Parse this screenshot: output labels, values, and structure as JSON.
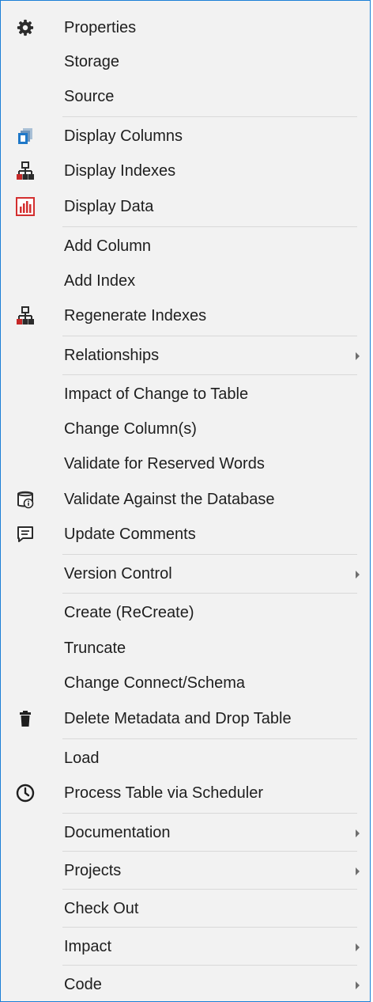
{
  "menu": {
    "items": [
      {
        "label": "Properties",
        "icon": "gear-icon"
      },
      {
        "label": "Storage",
        "icon": ""
      },
      {
        "label": "Source",
        "icon": ""
      },
      {
        "label": "Display Columns",
        "icon": "stacked-columns-icon"
      },
      {
        "label": "Display Indexes",
        "icon": "hierarchy-icon"
      },
      {
        "label": "Display Data",
        "icon": "bar-chart-icon"
      },
      {
        "label": "Add Column",
        "icon": ""
      },
      {
        "label": "Add Index",
        "icon": ""
      },
      {
        "label": "Regenerate Indexes",
        "icon": "hierarchy-icon"
      },
      {
        "label": "Relationships",
        "icon": "",
        "submenu": true
      },
      {
        "label": "Impact of Change to Table",
        "icon": ""
      },
      {
        "label": "Change Column(s)",
        "icon": ""
      },
      {
        "label": "Validate for Reserved Words",
        "icon": ""
      },
      {
        "label": "Validate Against the Database",
        "icon": "database-info-icon"
      },
      {
        "label": "Update Comments",
        "icon": "comment-icon"
      },
      {
        "label": "Version Control",
        "icon": "",
        "submenu": true
      },
      {
        "label": "Create (ReCreate)",
        "icon": ""
      },
      {
        "label": "Truncate",
        "icon": ""
      },
      {
        "label": "Change Connect/Schema",
        "icon": ""
      },
      {
        "label": "Delete Metadata and Drop Table",
        "icon": "trash-icon"
      },
      {
        "label": "Load",
        "icon": ""
      },
      {
        "label": "Process Table via Scheduler",
        "icon": "clock-icon"
      },
      {
        "label": "Documentation",
        "icon": "",
        "submenu": true
      },
      {
        "label": "Projects",
        "icon": "",
        "submenu": true
      },
      {
        "label": "Check Out",
        "icon": ""
      },
      {
        "label": "Impact",
        "icon": "",
        "submenu": true
      },
      {
        "label": "Code",
        "icon": "",
        "submenu": true
      }
    ],
    "colors": {
      "background": "#f2f2f2",
      "border": "#1c7fd6",
      "separator": "#d9d9d9",
      "text": "#1e1e1e"
    }
  }
}
